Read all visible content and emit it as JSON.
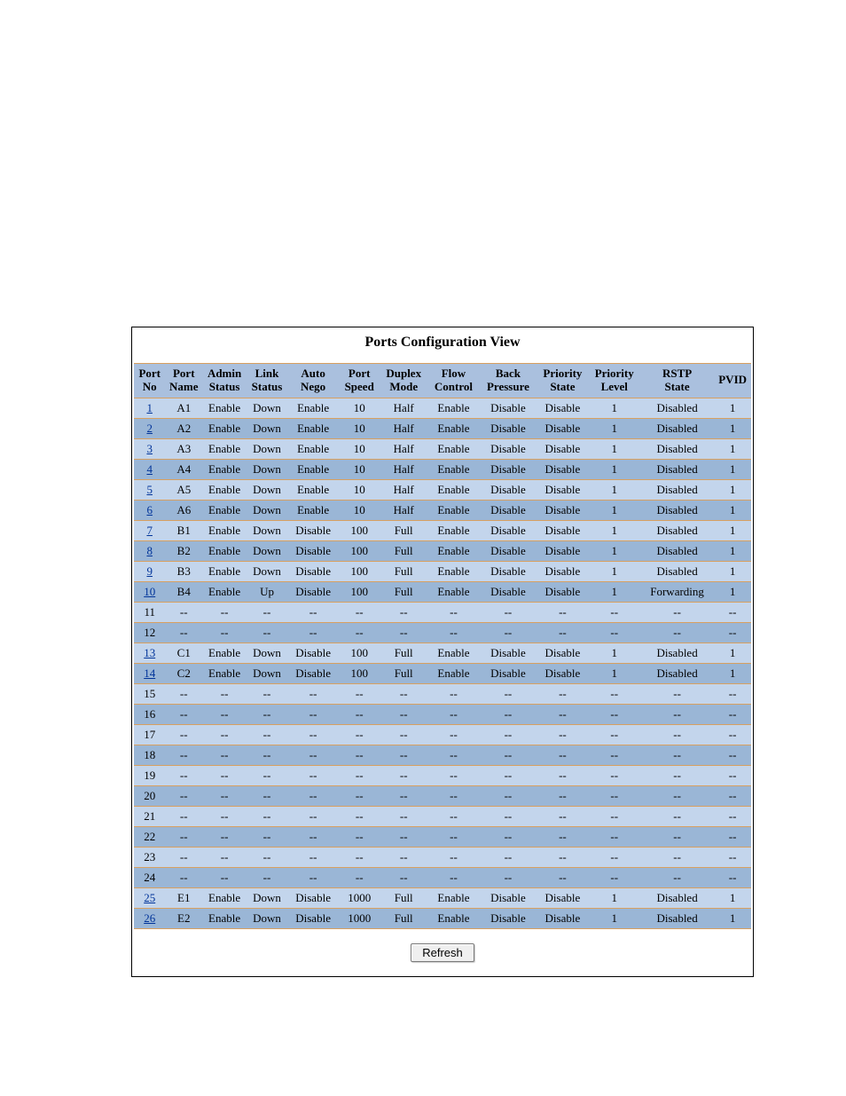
{
  "title": "Ports Configuration View",
  "refresh_label": "Refresh",
  "columns": [
    {
      "id": "port_no",
      "label1": "Port",
      "label2": "No"
    },
    {
      "id": "port_name",
      "label1": "Port",
      "label2": "Name"
    },
    {
      "id": "admin_status",
      "label1": "Admin",
      "label2": "Status"
    },
    {
      "id": "link_status",
      "label1": "Link",
      "label2": "Status"
    },
    {
      "id": "auto_nego",
      "label1": "Auto",
      "label2": "Nego"
    },
    {
      "id": "port_speed",
      "label1": "Port",
      "label2": "Speed"
    },
    {
      "id": "duplex_mode",
      "label1": "Duplex",
      "label2": "Mode"
    },
    {
      "id": "flow_control",
      "label1": "Flow",
      "label2": "Control"
    },
    {
      "id": "back_pressure",
      "label1": "Back",
      "label2": "Pressure"
    },
    {
      "id": "priority_state",
      "label1": "Priority",
      "label2": "State"
    },
    {
      "id": "priority_level",
      "label1": "Priority",
      "label2": "Level"
    },
    {
      "id": "rstp_state",
      "label1": "RSTP",
      "label2": "State"
    },
    {
      "id": "pvid",
      "label1": "PVID",
      "label2": ""
    }
  ],
  "rows": [
    {
      "port_no": "1",
      "link": true,
      "port_name": "A1",
      "admin_status": "Enable",
      "link_status": "Down",
      "auto_nego": "Enable",
      "port_speed": "10",
      "duplex_mode": "Half",
      "flow_control": "Enable",
      "back_pressure": "Disable",
      "priority_state": "Disable",
      "priority_level": "1",
      "rstp_state": "Disabled",
      "pvid": "1"
    },
    {
      "port_no": "2",
      "link": true,
      "port_name": "A2",
      "admin_status": "Enable",
      "link_status": "Down",
      "auto_nego": "Enable",
      "port_speed": "10",
      "duplex_mode": "Half",
      "flow_control": "Enable",
      "back_pressure": "Disable",
      "priority_state": "Disable",
      "priority_level": "1",
      "rstp_state": "Disabled",
      "pvid": "1"
    },
    {
      "port_no": "3",
      "link": true,
      "port_name": "A3",
      "admin_status": "Enable",
      "link_status": "Down",
      "auto_nego": "Enable",
      "port_speed": "10",
      "duplex_mode": "Half",
      "flow_control": "Enable",
      "back_pressure": "Disable",
      "priority_state": "Disable",
      "priority_level": "1",
      "rstp_state": "Disabled",
      "pvid": "1"
    },
    {
      "port_no": "4",
      "link": true,
      "port_name": "A4",
      "admin_status": "Enable",
      "link_status": "Down",
      "auto_nego": "Enable",
      "port_speed": "10",
      "duplex_mode": "Half",
      "flow_control": "Enable",
      "back_pressure": "Disable",
      "priority_state": "Disable",
      "priority_level": "1",
      "rstp_state": "Disabled",
      "pvid": "1"
    },
    {
      "port_no": "5",
      "link": true,
      "port_name": "A5",
      "admin_status": "Enable",
      "link_status": "Down",
      "auto_nego": "Enable",
      "port_speed": "10",
      "duplex_mode": "Half",
      "flow_control": "Enable",
      "back_pressure": "Disable",
      "priority_state": "Disable",
      "priority_level": "1",
      "rstp_state": "Disabled",
      "pvid": "1"
    },
    {
      "port_no": "6",
      "link": true,
      "port_name": "A6",
      "admin_status": "Enable",
      "link_status": "Down",
      "auto_nego": "Enable",
      "port_speed": "10",
      "duplex_mode": "Half",
      "flow_control": "Enable",
      "back_pressure": "Disable",
      "priority_state": "Disable",
      "priority_level": "1",
      "rstp_state": "Disabled",
      "pvid": "1"
    },
    {
      "port_no": "7",
      "link": true,
      "port_name": "B1",
      "admin_status": "Enable",
      "link_status": "Down",
      "auto_nego": "Disable",
      "port_speed": "100",
      "duplex_mode": "Full",
      "flow_control": "Enable",
      "back_pressure": "Disable",
      "priority_state": "Disable",
      "priority_level": "1",
      "rstp_state": "Disabled",
      "pvid": "1"
    },
    {
      "port_no": "8",
      "link": true,
      "port_name": "B2",
      "admin_status": "Enable",
      "link_status": "Down",
      "auto_nego": "Disable",
      "port_speed": "100",
      "duplex_mode": "Full",
      "flow_control": "Enable",
      "back_pressure": "Disable",
      "priority_state": "Disable",
      "priority_level": "1",
      "rstp_state": "Disabled",
      "pvid": "1"
    },
    {
      "port_no": "9",
      "link": true,
      "port_name": "B3",
      "admin_status": "Enable",
      "link_status": "Down",
      "auto_nego": "Disable",
      "port_speed": "100",
      "duplex_mode": "Full",
      "flow_control": "Enable",
      "back_pressure": "Disable",
      "priority_state": "Disable",
      "priority_level": "1",
      "rstp_state": "Disabled",
      "pvid": "1"
    },
    {
      "port_no": "10",
      "link": true,
      "port_name": "B4",
      "admin_status": "Enable",
      "link_status": "Up",
      "auto_nego": "Disable",
      "port_speed": "100",
      "duplex_mode": "Full",
      "flow_control": "Enable",
      "back_pressure": "Disable",
      "priority_state": "Disable",
      "priority_level": "1",
      "rstp_state": "Forwarding",
      "pvid": "1"
    },
    {
      "port_no": "11",
      "link": false,
      "port_name": "--",
      "admin_status": "--",
      "link_status": "--",
      "auto_nego": "--",
      "port_speed": "--",
      "duplex_mode": "--",
      "flow_control": "--",
      "back_pressure": "--",
      "priority_state": "--",
      "priority_level": "--",
      "rstp_state": "--",
      "pvid": "--"
    },
    {
      "port_no": "12",
      "link": false,
      "port_name": "--",
      "admin_status": "--",
      "link_status": "--",
      "auto_nego": "--",
      "port_speed": "--",
      "duplex_mode": "--",
      "flow_control": "--",
      "back_pressure": "--",
      "priority_state": "--",
      "priority_level": "--",
      "rstp_state": "--",
      "pvid": "--"
    },
    {
      "port_no": "13",
      "link": true,
      "port_name": "C1",
      "admin_status": "Enable",
      "link_status": "Down",
      "auto_nego": "Disable",
      "port_speed": "100",
      "duplex_mode": "Full",
      "flow_control": "Enable",
      "back_pressure": "Disable",
      "priority_state": "Disable",
      "priority_level": "1",
      "rstp_state": "Disabled",
      "pvid": "1"
    },
    {
      "port_no": "14",
      "link": true,
      "port_name": "C2",
      "admin_status": "Enable",
      "link_status": "Down",
      "auto_nego": "Disable",
      "port_speed": "100",
      "duplex_mode": "Full",
      "flow_control": "Enable",
      "back_pressure": "Disable",
      "priority_state": "Disable",
      "priority_level": "1",
      "rstp_state": "Disabled",
      "pvid": "1"
    },
    {
      "port_no": "15",
      "link": false,
      "port_name": "--",
      "admin_status": "--",
      "link_status": "--",
      "auto_nego": "--",
      "port_speed": "--",
      "duplex_mode": "--",
      "flow_control": "--",
      "back_pressure": "--",
      "priority_state": "--",
      "priority_level": "--",
      "rstp_state": "--",
      "pvid": "--"
    },
    {
      "port_no": "16",
      "link": false,
      "port_name": "--",
      "admin_status": "--",
      "link_status": "--",
      "auto_nego": "--",
      "port_speed": "--",
      "duplex_mode": "--",
      "flow_control": "--",
      "back_pressure": "--",
      "priority_state": "--",
      "priority_level": "--",
      "rstp_state": "--",
      "pvid": "--"
    },
    {
      "port_no": "17",
      "link": false,
      "port_name": "--",
      "admin_status": "--",
      "link_status": "--",
      "auto_nego": "--",
      "port_speed": "--",
      "duplex_mode": "--",
      "flow_control": "--",
      "back_pressure": "--",
      "priority_state": "--",
      "priority_level": "--",
      "rstp_state": "--",
      "pvid": "--"
    },
    {
      "port_no": "18",
      "link": false,
      "port_name": "--",
      "admin_status": "--",
      "link_status": "--",
      "auto_nego": "--",
      "port_speed": "--",
      "duplex_mode": "--",
      "flow_control": "--",
      "back_pressure": "--",
      "priority_state": "--",
      "priority_level": "--",
      "rstp_state": "--",
      "pvid": "--"
    },
    {
      "port_no": "19",
      "link": false,
      "port_name": "--",
      "admin_status": "--",
      "link_status": "--",
      "auto_nego": "--",
      "port_speed": "--",
      "duplex_mode": "--",
      "flow_control": "--",
      "back_pressure": "--",
      "priority_state": "--",
      "priority_level": "--",
      "rstp_state": "--",
      "pvid": "--"
    },
    {
      "port_no": "20",
      "link": false,
      "port_name": "--",
      "admin_status": "--",
      "link_status": "--",
      "auto_nego": "--",
      "port_speed": "--",
      "duplex_mode": "--",
      "flow_control": "--",
      "back_pressure": "--",
      "priority_state": "--",
      "priority_level": "--",
      "rstp_state": "--",
      "pvid": "--"
    },
    {
      "port_no": "21",
      "link": false,
      "port_name": "--",
      "admin_status": "--",
      "link_status": "--",
      "auto_nego": "--",
      "port_speed": "--",
      "duplex_mode": "--",
      "flow_control": "--",
      "back_pressure": "--",
      "priority_state": "--",
      "priority_level": "--",
      "rstp_state": "--",
      "pvid": "--"
    },
    {
      "port_no": "22",
      "link": false,
      "port_name": "--",
      "admin_status": "--",
      "link_status": "--",
      "auto_nego": "--",
      "port_speed": "--",
      "duplex_mode": "--",
      "flow_control": "--",
      "back_pressure": "--",
      "priority_state": "--",
      "priority_level": "--",
      "rstp_state": "--",
      "pvid": "--"
    },
    {
      "port_no": "23",
      "link": false,
      "port_name": "--",
      "admin_status": "--",
      "link_status": "--",
      "auto_nego": "--",
      "port_speed": "--",
      "duplex_mode": "--",
      "flow_control": "--",
      "back_pressure": "--",
      "priority_state": "--",
      "priority_level": "--",
      "rstp_state": "--",
      "pvid": "--"
    },
    {
      "port_no": "24",
      "link": false,
      "port_name": "--",
      "admin_status": "--",
      "link_status": "--",
      "auto_nego": "--",
      "port_speed": "--",
      "duplex_mode": "--",
      "flow_control": "--",
      "back_pressure": "--",
      "priority_state": "--",
      "priority_level": "--",
      "rstp_state": "--",
      "pvid": "--"
    },
    {
      "port_no": "25",
      "link": true,
      "port_name": "E1",
      "admin_status": "Enable",
      "link_status": "Down",
      "auto_nego": "Disable",
      "port_speed": "1000",
      "duplex_mode": "Full",
      "flow_control": "Enable",
      "back_pressure": "Disable",
      "priority_state": "Disable",
      "priority_level": "1",
      "rstp_state": "Disabled",
      "pvid": "1"
    },
    {
      "port_no": "26",
      "link": true,
      "port_name": "E2",
      "admin_status": "Enable",
      "link_status": "Down",
      "auto_nego": "Disable",
      "port_speed": "1000",
      "duplex_mode": "Full",
      "flow_control": "Enable",
      "back_pressure": "Disable",
      "priority_state": "Disable",
      "priority_level": "1",
      "rstp_state": "Disabled",
      "pvid": "1"
    }
  ]
}
